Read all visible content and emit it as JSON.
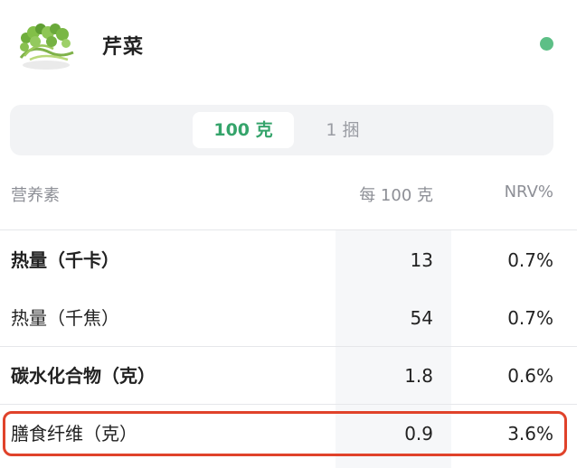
{
  "food": {
    "name": "芹菜",
    "thumb_icon": "celery-image"
  },
  "status": {
    "color": "#5dbf86"
  },
  "unit_selector": {
    "options": [
      "100 克",
      "1 捆"
    ],
    "selected": "100 克",
    "active_color": "#35a46b"
  },
  "table": {
    "headers": {
      "nutrient": "营养素",
      "per100": "每 100 克",
      "nrv": "NRV%"
    },
    "rows": [
      {
        "nutrient": "热量（千卡）",
        "per100": "13",
        "nrv": "0.7%"
      },
      {
        "nutrient": "热量（千焦）",
        "per100": "54",
        "nrv": "0.7%"
      },
      {
        "nutrient": "碳水化合物（克）",
        "per100": "1.8",
        "nrv": "0.6%"
      },
      {
        "nutrient": "膳食纤维（克）",
        "per100": "0.9",
        "nrv": "3.6%"
      }
    ],
    "highlighted_row": "膳食纤维（克）",
    "highlight_color": "#e0422a"
  }
}
